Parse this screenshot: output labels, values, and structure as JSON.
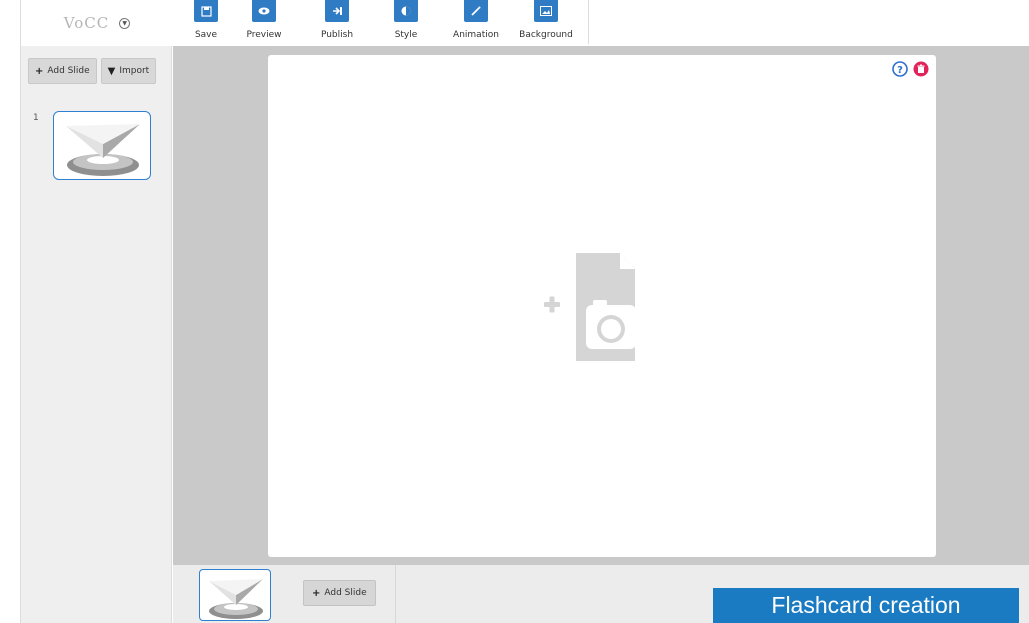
{
  "logo": {
    "text": "VoCC"
  },
  "toolbar": {
    "save_label": "Save",
    "preview_label": "Preview",
    "publish_label": "Publish",
    "style_label": "Style",
    "animation_label": "Animation",
    "background_label": "Background",
    "accent_color": "#2f7cc5"
  },
  "sidebar": {
    "add_slide_label": "Add Slide",
    "import_label": "Import",
    "slides": [
      {
        "number": "1"
      }
    ]
  },
  "slide": {
    "help_icon": "help-icon",
    "delete_icon": "trash-icon",
    "placeholder_icon": "add-image-icon"
  },
  "bottom": {
    "add_slide_label": "Add Slide"
  },
  "caption": {
    "text": "Flashcard creation",
    "color": "#1a7bc2"
  }
}
